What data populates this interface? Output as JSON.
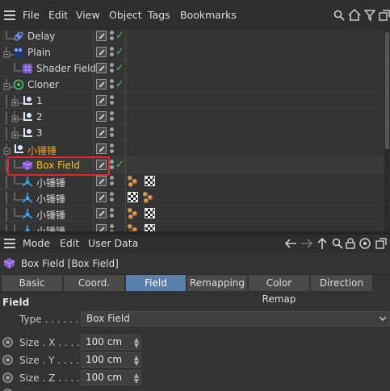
{
  "menubar": {
    "items": [
      "File",
      "Edit",
      "View",
      "Object",
      "Tags",
      "Bookmarks"
    ],
    "tools": [
      "search-icon",
      "home-icon",
      "filter-icon",
      "new-view-icon"
    ]
  },
  "tree": {
    "rows": [
      {
        "name": "Delay",
        "icon": "delay-effector-icon",
        "level": 1,
        "check": true
      },
      {
        "name": "Plain",
        "icon": "plain-effector-icon",
        "level": 1,
        "check": true
      },
      {
        "name": "Shader Field",
        "icon": "shader-field-icon",
        "level": 2,
        "check": true
      },
      {
        "name": "Cloner",
        "icon": "cloner-icon",
        "level": 1,
        "check": true
      },
      {
        "name": "1",
        "icon": "null-object-icon",
        "level": 2,
        "check": false
      },
      {
        "name": "2",
        "icon": "null-object-icon",
        "level": 2,
        "check": false
      },
      {
        "name": "3",
        "icon": "null-object-icon",
        "level": 2,
        "check": false
      },
      {
        "name": "小锤锤",
        "icon": "null-object-icon",
        "level": 1,
        "check": false
      },
      {
        "name": "Box Field",
        "icon": "box-field-icon",
        "level": 2,
        "check": true
      },
      {
        "name": "小锤锤",
        "icon": "joint-icon",
        "level": 2,
        "check": false
      },
      {
        "name": "小锤锤",
        "icon": "joint-icon",
        "level": 2,
        "check": false
      },
      {
        "name": "小锤锤",
        "icon": "joint-icon",
        "level": 2,
        "check": false
      },
      {
        "name": "小锤锤",
        "icon": "joint-icon",
        "level": 2,
        "check": false
      }
    ]
  },
  "attributes": {
    "menu": [
      "Mode",
      "Edit",
      "User Data"
    ],
    "title": "Box Field [Box Field]",
    "tabs": [
      "Basic",
      "Coord.",
      "Field",
      "Remapping",
      "Color Remap",
      "Direction"
    ],
    "active_tab": "Field",
    "section": "Field",
    "type_label": "Type . . . . . .",
    "type_value": "Box Field",
    "size_x_label": "Size . X . . . . .",
    "size_x_value": "100 cm",
    "size_y_label": "Size . Y . . . . .",
    "size_y_value": "100 cm",
    "size_z_label": "Size . Z . . . . .",
    "size_z_value": "100 cm"
  },
  "colors": {
    "accent_tab": "#5b7fa8",
    "selection_box": "#e02828",
    "check": "#39c565",
    "orange_text": "#e8a23a",
    "yellow_text": "#f2c41f"
  }
}
